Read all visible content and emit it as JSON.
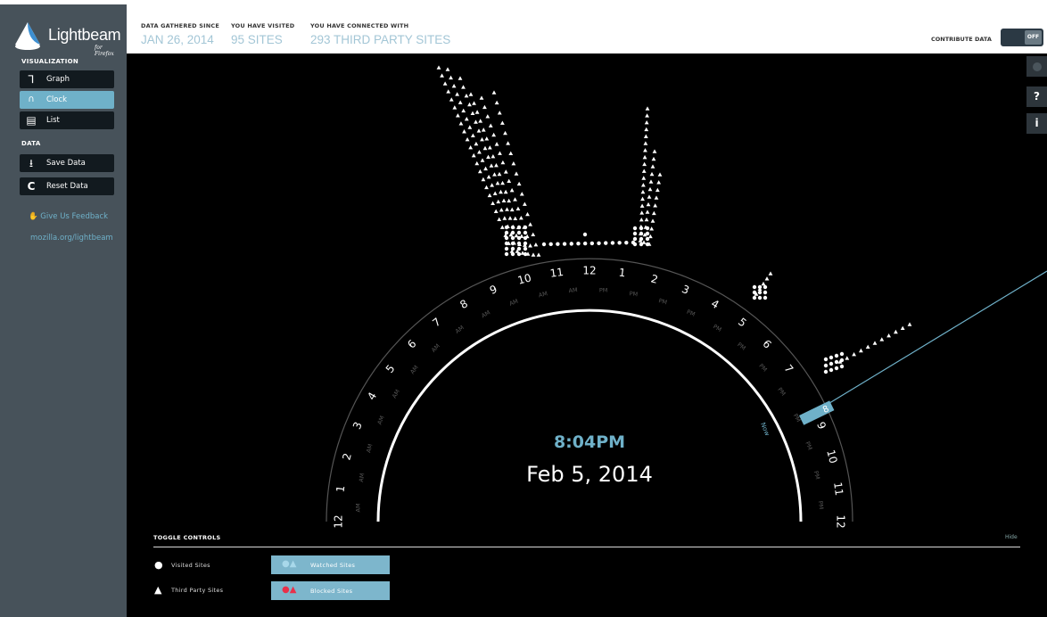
{
  "app": {
    "logo_text": "Lightbeam",
    "logo_sub": "for Firefox"
  },
  "sidebar": {
    "visualization_label": "VISUALIZATION",
    "viz_items": [
      {
        "label": "Graph",
        "icon": "graph-icon",
        "active": false
      },
      {
        "label": "Clock",
        "icon": "clock-icon",
        "active": true
      },
      {
        "label": "List",
        "icon": "list-icon",
        "active": false
      }
    ],
    "data_label": "DATA",
    "data_items": [
      {
        "label": "Save Data",
        "icon": "download-icon"
      },
      {
        "label": "Reset Data",
        "icon": "reset-icon"
      }
    ],
    "feedback_label": "Give Us Feedback",
    "site_link": "mozilla.org/lightbeam"
  },
  "header": {
    "stats": [
      {
        "label": "DATA GATHERED SINCE",
        "value": "JAN 26, 2014"
      },
      {
        "label": "YOU HAVE VISITED",
        "value": "95 SITES"
      },
      {
        "label": "YOU HAVE CONNECTED WITH",
        "value": "293 THIRD PARTY SITES"
      }
    ],
    "contribute_label": "CONTRIBUTE DATA",
    "toggle_state": "OFF"
  },
  "side_controls": [
    {
      "icon": "settings-icon",
      "glyph": ""
    },
    {
      "icon": "help-icon",
      "glyph": "?"
    },
    {
      "icon": "info-icon",
      "glyph": "i"
    }
  ],
  "clock": {
    "time": "8:04PM",
    "date": "Feb 5, 2014",
    "now_label": "Now",
    "current_hour_label": "8",
    "am_label": "AM",
    "pm_label": "PM",
    "hours_am": [
      "12",
      "1",
      "2",
      "3",
      "4",
      "5",
      "6",
      "7",
      "8",
      "9",
      "10",
      "11"
    ],
    "hours_pm": [
      "12",
      "1",
      "2",
      "3",
      "4",
      "5",
      "6",
      "7",
      "8",
      "9",
      "10",
      "11",
      "12"
    ]
  },
  "toggle_controls": {
    "title": "TOGGLE CONTROLS",
    "hide_label": "Hide",
    "visited_label": "Visited Sites",
    "third_party_label": "Third Party Sites",
    "watched_label": "Watched Sites",
    "blocked_label": "Blocked Sites"
  },
  "colors": {
    "accent": "#6fb1c9",
    "sidebar_bg": "#47525a",
    "blocked": "#e8304a"
  }
}
